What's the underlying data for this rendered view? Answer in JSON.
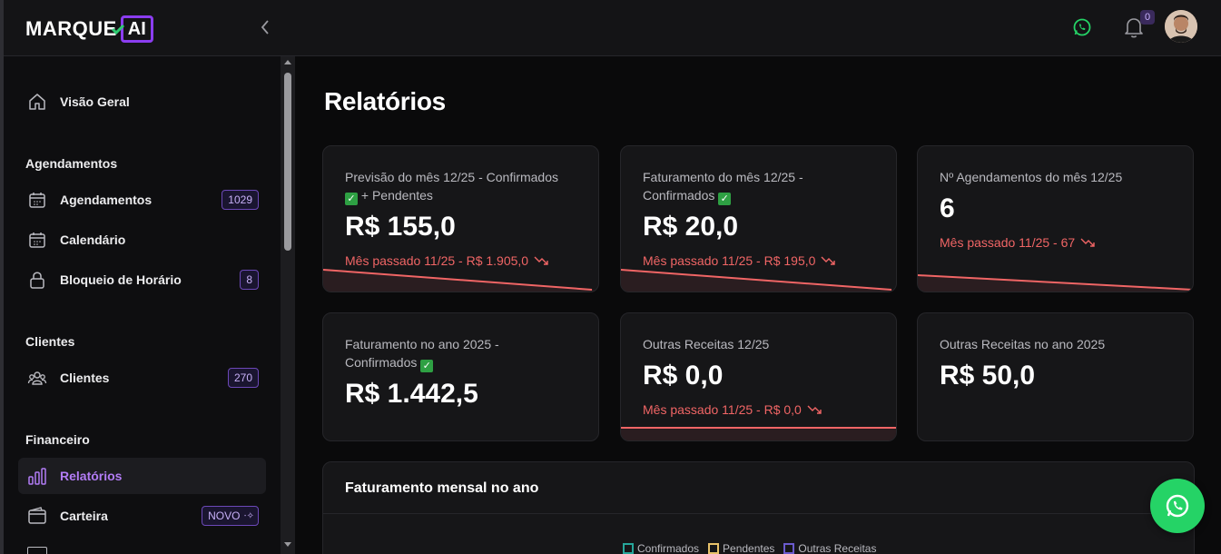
{
  "brand": {
    "name": "MARQUE",
    "suffix": "AI",
    "accent": "#8b3df0"
  },
  "header": {
    "notifications_count": "0"
  },
  "sidebar": {
    "overview": "Visão Geral",
    "sections": {
      "agendamentos": "Agendamentos",
      "clientes": "Clientes",
      "financeiro": "Financeiro"
    },
    "items": {
      "agendamentos": {
        "label": "Agendamentos",
        "badge": "1029",
        "icon": "calendar-icon"
      },
      "calendario": {
        "label": "Calendário",
        "icon": "calendar-icon"
      },
      "bloqueio": {
        "label": "Bloqueio de Horário",
        "badge": "8",
        "icon": "lock-icon"
      },
      "clientes": {
        "label": "Clientes",
        "badge": "270",
        "icon": "users-icon"
      },
      "relatorios": {
        "label": "Relatórios",
        "icon": "bar-chart-icon"
      },
      "carteira": {
        "label": "Carteira",
        "badge": "NOVO",
        "icon": "wallet-icon"
      }
    }
  },
  "main": {
    "title": "Relatórios",
    "cards": [
      {
        "label": "Previsão do mês 12/25 - Confirmados",
        "label2": "+ Pendentes",
        "value": "R$ 155,0",
        "sub": "Mês passado 11/25 - R$ 1.905,0",
        "trend": "down"
      },
      {
        "label": "Faturamento do mês 12/25 -",
        "label2": "Confirmados",
        "value": "R$ 20,0",
        "sub": "Mês passado 11/25 - R$ 195,0",
        "trend": "down"
      },
      {
        "label": "Nº Agendamentos do mês 12/25",
        "value": "6",
        "sub": "Mês passado 11/25 - 67",
        "trend": "down"
      },
      {
        "label": "Faturamento no ano 2025 -",
        "label2": "Confirmados",
        "value": "R$ 1.442,5"
      },
      {
        "label": "Outras Receitas 12/25",
        "value": "R$ 0,0",
        "sub": "Mês passado 11/25 - R$ 0,0",
        "trend": "down"
      },
      {
        "label": "Outras Receitas no ano 2025",
        "value": "R$ 50,0"
      }
    ],
    "chart": {
      "title": "Faturamento mensal no ano",
      "legend": [
        {
          "name": "Confirmados",
          "color": "#26a69a"
        },
        {
          "name": "Pendentes",
          "color": "#e8c26a"
        },
        {
          "name": "Outras Receitas",
          "color": "#6a5acd"
        }
      ]
    }
  },
  "colors": {
    "negative": "#f06565",
    "whatsapp": "#25d366"
  }
}
